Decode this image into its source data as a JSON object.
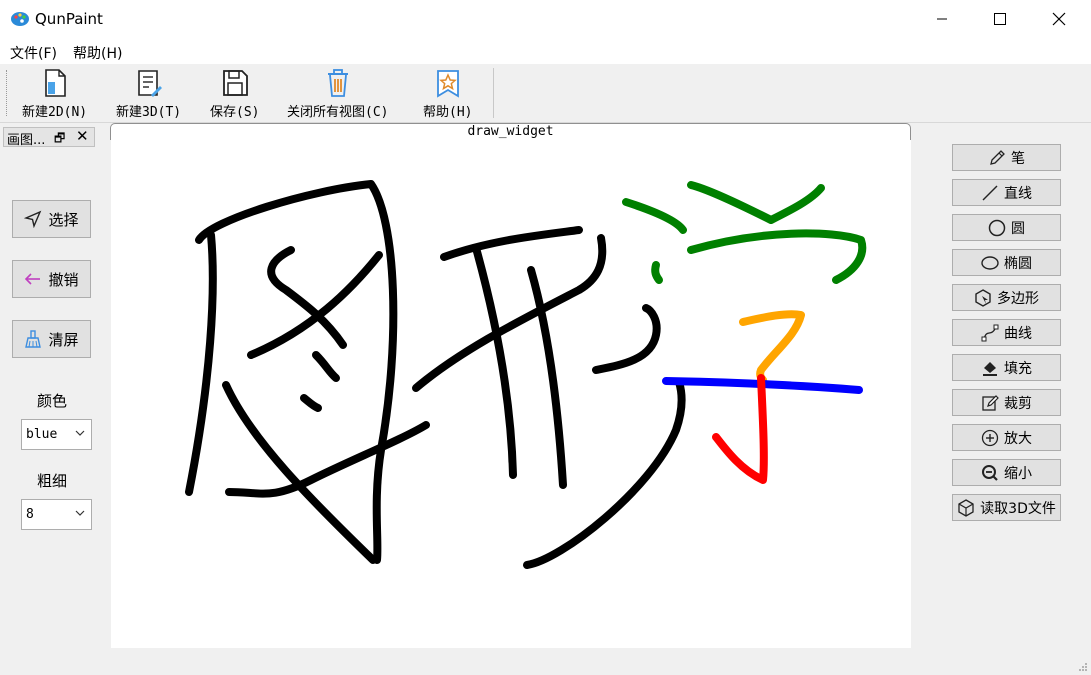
{
  "window": {
    "title": "QunPaint",
    "controls": [
      "minimize",
      "maximize",
      "close"
    ]
  },
  "menu": {
    "file": "文件(F)",
    "help": "帮助(H)"
  },
  "toolbar": {
    "items": [
      {
        "label": "新建2D(N)",
        "icon": "new-2d-icon"
      },
      {
        "label": "新建3D(T)",
        "icon": "new-3d-icon"
      },
      {
        "label": "保存(S)",
        "icon": "save-icon"
      },
      {
        "label": "关闭所有视图(C)",
        "icon": "trash-icon"
      },
      {
        "label": "帮助(H)",
        "icon": "help-star-icon"
      }
    ]
  },
  "dock": {
    "title": "画图...",
    "select_label": "选择",
    "undo_label": "撤销",
    "clear_label": "清屏",
    "color_label": "颜色",
    "color_value": "blue",
    "width_label": "粗细",
    "width_value": "8"
  },
  "canvas": {
    "tab_title": "draw_widget",
    "strokes": [
      {
        "color": "#000000",
        "count": 14
      },
      {
        "color": "#008000",
        "count": 3
      },
      {
        "color": "#ffa500",
        "count": 1
      },
      {
        "color": "#0000ff",
        "count": 1
      },
      {
        "color": "#ff0000",
        "count": 1
      }
    ]
  },
  "tools": {
    "items": [
      {
        "label": "笔",
        "icon": "pencil-icon"
      },
      {
        "label": "直线",
        "icon": "line-icon"
      },
      {
        "label": "圆",
        "icon": "circle-icon"
      },
      {
        "label": "椭圆",
        "icon": "ellipse-icon"
      },
      {
        "label": "多边形",
        "icon": "polygon-icon"
      },
      {
        "label": "曲线",
        "icon": "curve-icon"
      },
      {
        "label": "填充",
        "icon": "fill-bucket-icon"
      },
      {
        "label": "裁剪",
        "icon": "crop-edit-icon"
      },
      {
        "label": "放大",
        "icon": "zoom-in-icon"
      },
      {
        "label": "缩小",
        "icon": "zoom-out-icon"
      },
      {
        "label": "读取3D文件",
        "icon": "cube-icon"
      }
    ]
  },
  "colors": {
    "black": "#000000",
    "green": "#008000",
    "orange": "#ffa500",
    "blue": "#0000ff",
    "red": "#ff0000"
  }
}
